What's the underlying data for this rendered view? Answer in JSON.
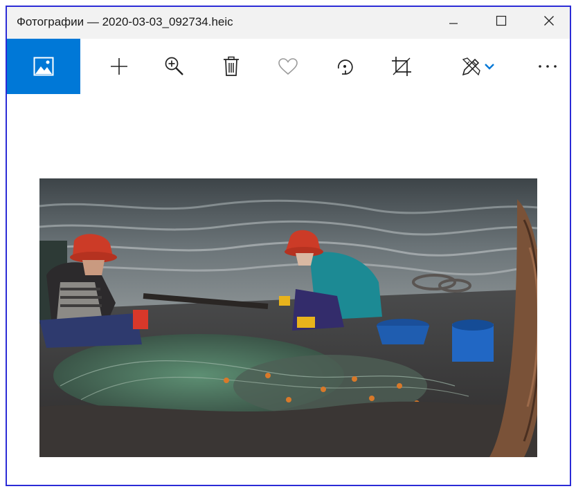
{
  "window": {
    "title": "Фотографии — 2020-03-03_092734.heic"
  },
  "caption_buttons": [
    "minimize",
    "maximize",
    "close"
  ],
  "toolbar": {
    "items": [
      {
        "icon": "image-icon",
        "active": true
      },
      {
        "icon": "plus-icon"
      },
      {
        "icon": "zoom-in-icon"
      },
      {
        "icon": "trash-icon"
      },
      {
        "icon": "heart-icon",
        "disabled": true
      },
      {
        "icon": "rotate-icon"
      },
      {
        "icon": "crop-icon"
      },
      {
        "icon": "pen-edit-icon"
      },
      {
        "icon": "chevron-down-icon"
      },
      {
        "icon": "more-icon"
      }
    ]
  },
  "colors": {
    "accent": "#0078d7",
    "window_border": "#2b2bd6",
    "titlebar": "#f2f2f2",
    "icon": "#222222",
    "icon_disabled": "#9a9a9a"
  },
  "photo": {
    "subject": "fishing-net-workers"
  }
}
